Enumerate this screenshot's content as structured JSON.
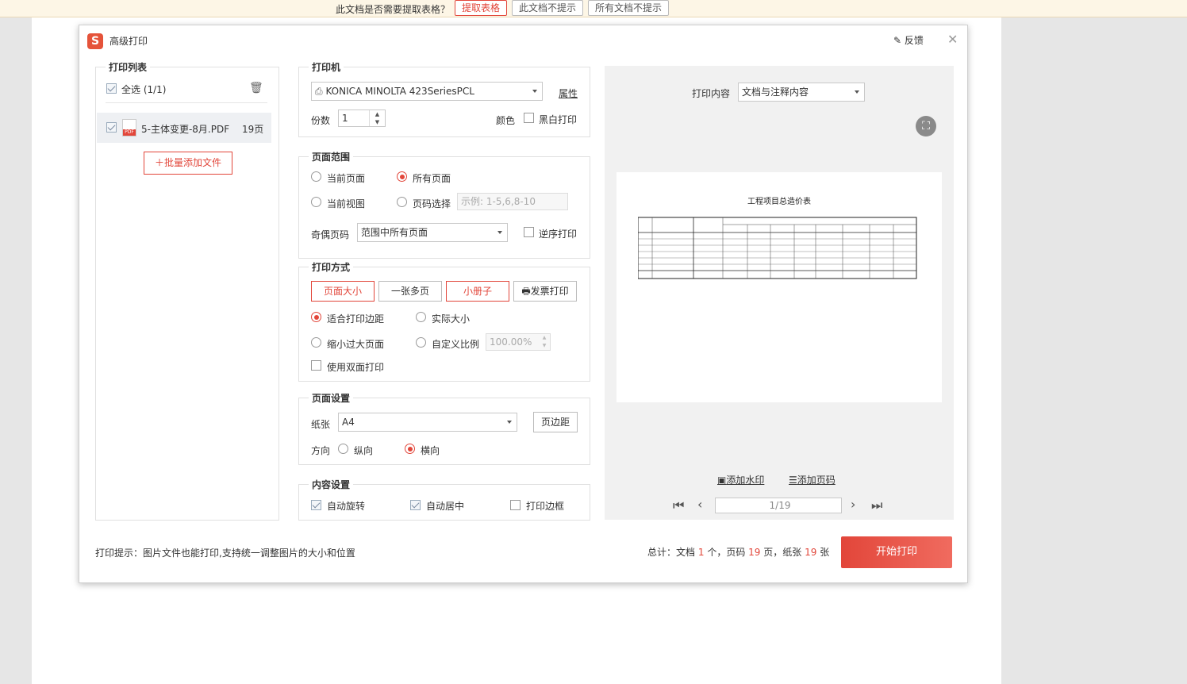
{
  "infobar": {
    "question": "此文档是否需要提取表格？",
    "extract_btn": "提取表格",
    "no_prompt_doc": "此文档不提示",
    "no_prompt_all": "所有文档不提示"
  },
  "dialog": {
    "title": "高级打印",
    "feedback": "反馈",
    "logo_text": "S"
  },
  "print_list": {
    "title": "打印列表",
    "select_all": "全选 (1/1)",
    "file_name": "5-主体变更-8月.PDF",
    "file_pages": "19页",
    "add_files": "批量添加文件"
  },
  "printer": {
    "title": "打印机",
    "selected": "KONICA MINOLTA 423SeriesPCL",
    "properties": "属性",
    "copies_label": "份数",
    "copies_value": "1",
    "color_label": "颜色",
    "bw_label": "黑白打印"
  },
  "page_range": {
    "title": "页面范围",
    "current_page": "当前页面",
    "all_pages": "所有页面",
    "current_view": "当前视图",
    "page_select": "页码选择",
    "page_select_placeholder": "示例: 1-5,6,8-10",
    "odd_even_label": "奇偶页码",
    "odd_even_value": "范围中所有页面",
    "reverse": "逆序打印"
  },
  "print_mode": {
    "title": "打印方式",
    "page_size": "页面大小",
    "multi_page": "一张多页",
    "booklet": "小册子",
    "invoice": "发票打印",
    "fit_margin": "适合打印边距",
    "actual_size": "实际大小",
    "shrink": "缩小过大页面",
    "custom_scale": "自定义比例",
    "scale_value": "100.00%",
    "duplex": "使用双面打印"
  },
  "page_setup": {
    "title": "页面设置",
    "paper_label": "纸张",
    "paper_value": "A4",
    "margin_btn": "页边距",
    "orientation_label": "方向",
    "portrait": "纵向",
    "landscape": "横向"
  },
  "content_setup": {
    "title": "内容设置",
    "auto_rotate": "自动旋转",
    "auto_center": "自动居中",
    "print_border": "打印边框"
  },
  "preview": {
    "content_label": "打印内容",
    "content_value": "文档与注释内容",
    "doc_title": "工程项目总造价表",
    "add_watermark": "添加水印",
    "add_page_number": "添加页码",
    "page_indicator": "1/19"
  },
  "footer": {
    "tip": "打印提示：图片文件也能打印,支持统一调整图片的大小和位置",
    "summary_prefix": "总计：文档",
    "doc_count": "1",
    "summary_mid1": "个，页码",
    "page_count": "19",
    "summary_mid2": "页，纸张",
    "sheet_count": "19",
    "summary_suffix": "张",
    "start_print": "开始打印"
  }
}
